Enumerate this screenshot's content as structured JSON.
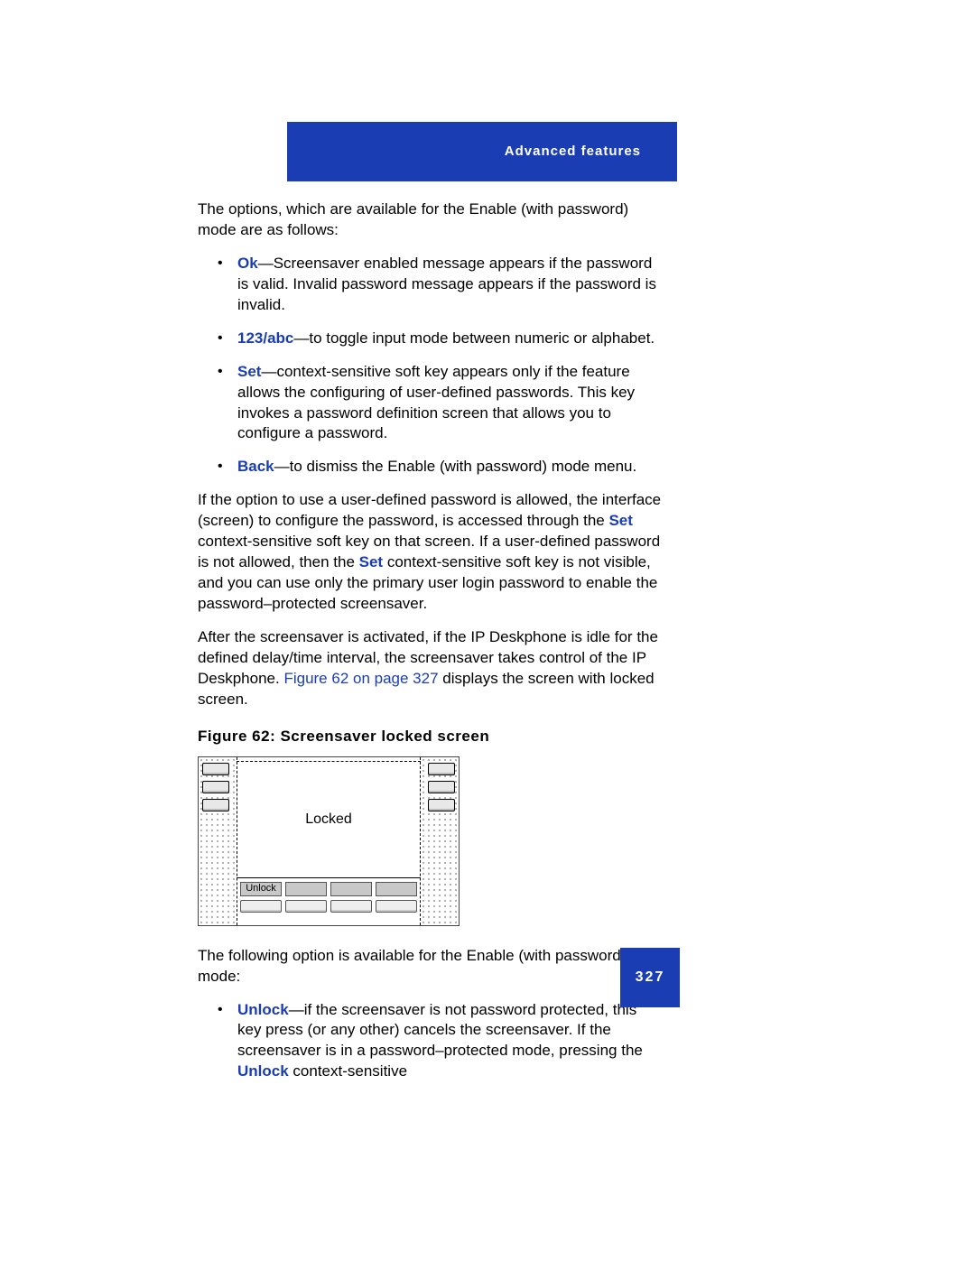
{
  "header": {
    "title": "Advanced features"
  },
  "intro": "The options, which are available for the Enable (with password) mode are as follows:",
  "options1": [
    {
      "kw": "Ok",
      "text": "—Screensaver enabled message appears if the password is valid. Invalid password message appears if the password is invalid."
    },
    {
      "kw": "123/abc",
      "text": "—to toggle input mode between numeric or alphabet."
    },
    {
      "kw": "Set",
      "text": "—context-sensitive soft key appears only if the feature allows the configuring of user-defined passwords. This key invokes a password definition screen that allows you to configure a password."
    },
    {
      "kw": "Back",
      "text": "—to dismiss the Enable (with password) mode menu."
    }
  ],
  "para2": {
    "pre": "If the option to use a user-defined password is allowed, the interface (screen) to configure the password, is accessed through the ",
    "set1": "Set",
    "mid": " context-sensitive soft key on that screen. If a user-defined password is not allowed, then the ",
    "set2": "Set",
    "post": " context-sensitive soft key is not visible, and you can use only the primary user login password to enable the password–protected screensaver."
  },
  "para3": {
    "pre": "After the screensaver is activated, if the IP Deskphone is idle for the defined delay/time interval, the screensaver takes control of the IP Deskphone. ",
    "xref": "Figure 62 on page 327",
    "post": " displays the screen with locked screen."
  },
  "figcap": "Figure 62: Screensaver locked screen",
  "phone": {
    "locked": "Locked",
    "unlock": "Unlock"
  },
  "para4": "The following option is available for the Enable (with password) mode:",
  "options2": [
    {
      "kw": "Unlock",
      "pre": "—if the screensaver is not password protected, this key press (or any other) cancels the screensaver. If the screensaver is in a password–protected mode, pressing the ",
      "kw2": "Unlock",
      "post": " context-sensitive"
    }
  ],
  "pageNumber": "327"
}
